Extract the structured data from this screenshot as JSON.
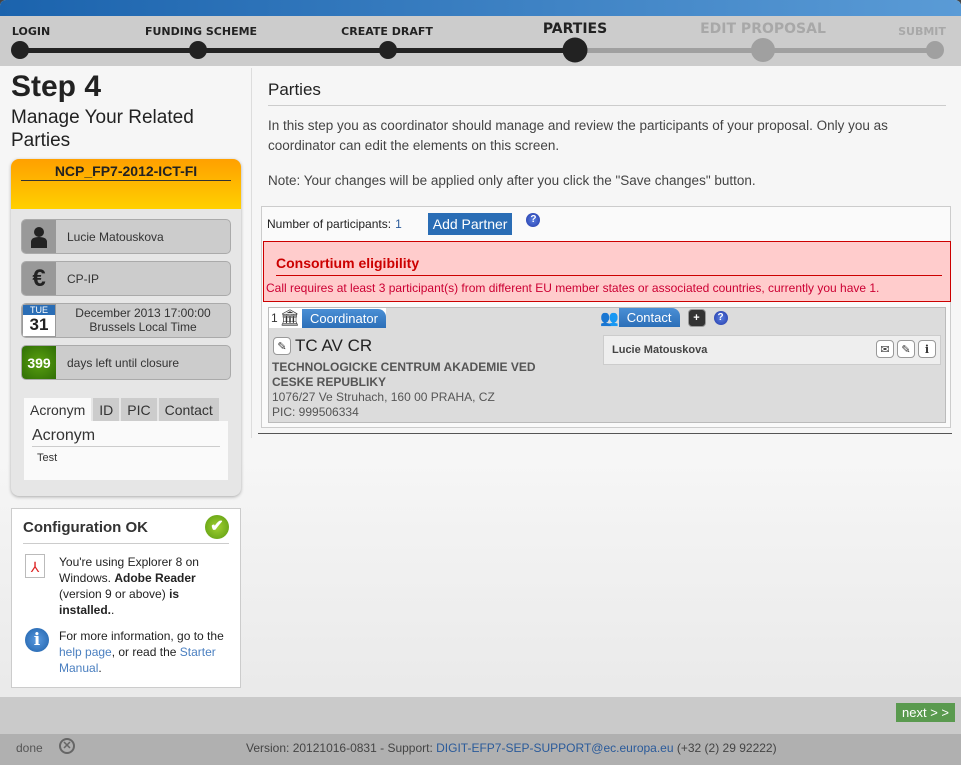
{
  "steps": [
    {
      "label": "LOGIN",
      "state": "done"
    },
    {
      "label": "FUNDING SCHEME",
      "state": "done"
    },
    {
      "label": "CREATE DRAFT",
      "state": "done"
    },
    {
      "label": "PARTIES",
      "state": "active"
    },
    {
      "label": "EDIT PROPOSAL",
      "state": "todo"
    },
    {
      "label": "SUBMIT",
      "state": "todo"
    }
  ],
  "left": {
    "step_title": "Step 4",
    "step_subtitle": "Manage Your Related Parties",
    "proposal_code": "NCP_FP7-2012-ICT-FI",
    "user": "Lucie Matouskova",
    "scheme": "CP-IP",
    "deadline_day_name": "TUE",
    "deadline_day": "31",
    "deadline_line1": "December 2013 17:00:00",
    "deadline_line2": "Brussels Local Time",
    "days_left": "399",
    "days_left_label": "days left until closure",
    "tabs": [
      "Acronym",
      "ID",
      "PIC",
      "Contact"
    ],
    "tab_heading": "Acronym",
    "tab_value": "Test"
  },
  "config": {
    "title": "Configuration OK",
    "msg_part1": "You're using Explorer 8 on Windows. ",
    "msg_bold1": "Adobe Reader",
    "msg_part2": " (version 9 or above) ",
    "msg_bold2": "is installed.",
    "msg_part3": ".",
    "info_part1": "For more information, go to the ",
    "help_link": "help page",
    "info_part2": ", or read the ",
    "manual_link": "Starter Manual",
    "info_part3": "."
  },
  "main": {
    "title": "Parties",
    "intro": "In this step you as coordinator should manage and review the participants of your proposal. Only you as coordinator can edit the elements on this screen.",
    "note": "Note: Your changes will be applied only after you click the \"Save changes\" button.",
    "participants_label": "Number of participants:",
    "participants_count": "1",
    "add_partner": "Add Partner",
    "error_title": "Consortium eligibility",
    "error_msg": "Call requires at least 3 participant(s) from different EU member states or associated countries, currently you have 1.",
    "party": {
      "number": "1",
      "role": "Coordinator",
      "short_name": "TC AV CR",
      "legal_name": "TECHNOLOGICKE CENTRUM AKADEMIE VED CESKE REPUBLIKY",
      "address": "1076/27 Ve Struhach, 160 00 PRAHA, CZ",
      "pic": "PIC: 999506334",
      "contact_label": "Contact",
      "contact_name": "Lucie Matouskova"
    }
  },
  "footer": {
    "next": "next > >",
    "status": "done",
    "version_text": "Version: 20121016-0831 - Support: ",
    "support_email": "DIGIT-EFP7-SEP-SUPPORT@ec.europa.eu",
    "phone": " (+32 (2) 29 92222)"
  },
  "colors": {
    "accent": "#2a6db5",
    "error_bg": "#ffcccc",
    "error_text": "#cc0000",
    "next_button": "#5a9a4f",
    "header_orange": "#ffa000"
  }
}
